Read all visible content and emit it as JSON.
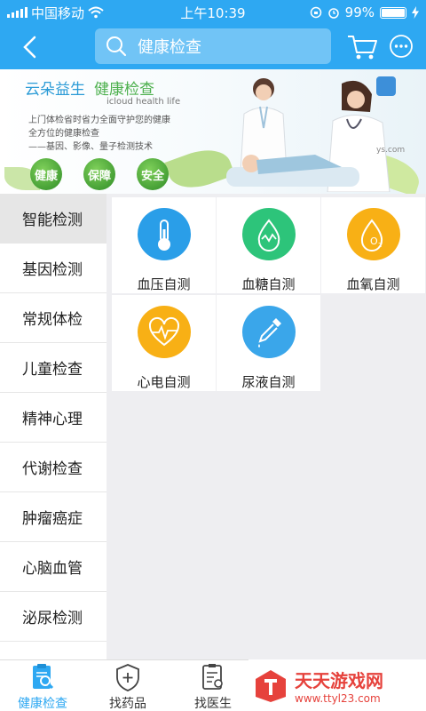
{
  "status_bar": {
    "carrier": "中国移动",
    "time": "上午10:39",
    "battery_percent": "99%",
    "battery_level": 0.99
  },
  "header": {
    "back_icon": "back-chevron-icon",
    "search_placeholder": "健康检查",
    "cart_icon": "cart-icon",
    "more_icon": "more-icon"
  },
  "banner": {
    "brand_left": "云朵益生",
    "brand_right": "健康检查",
    "subtitle": "icloud health life",
    "line1": "上门体检省时省力全面守护您的健康",
    "line2": "全方位的健康检查",
    "line3": "——基因、影像、量子检测技术",
    "badges": [
      "健康",
      "保障",
      "安全"
    ],
    "website_fragment": "ys.com"
  },
  "sidebar": {
    "items": [
      {
        "label": "智能检测",
        "active": true
      },
      {
        "label": "基因检测"
      },
      {
        "label": "常规体检"
      },
      {
        "label": "儿童检查"
      },
      {
        "label": "精神心理"
      },
      {
        "label": "代谢检查"
      },
      {
        "label": "肿瘤癌症"
      },
      {
        "label": "心脑血管"
      },
      {
        "label": "泌尿检测"
      }
    ]
  },
  "grid": {
    "items": [
      {
        "label": "血压自测",
        "icon": "thermometer-icon",
        "color": "#2a9ee8"
      },
      {
        "label": "血糖自测",
        "icon": "drop-wave-icon",
        "color": "#2dc47a"
      },
      {
        "label": "血氧自测",
        "icon": "o2-drop-icon",
        "color": "#f8b015"
      },
      {
        "label": "心电自测",
        "icon": "heart-pulse-icon",
        "color": "#f8b015"
      },
      {
        "label": "尿液自测",
        "icon": "dropper-icon",
        "color": "#3aa6ea"
      }
    ]
  },
  "bottom_nav": {
    "items": [
      {
        "label": "健康检查",
        "icon": "clipboard-search-icon",
        "active": true
      },
      {
        "label": "找药品",
        "icon": "shield-plus-icon"
      },
      {
        "label": "找医生",
        "icon": "doctor-list-icon"
      }
    ]
  },
  "watermark": {
    "title": "天天游戏网",
    "url": "www.ttyl23.com"
  },
  "colors": {
    "primary": "#2ea8f2",
    "search_bg": "#71c4f6",
    "active_sidebar": "#e6e6e6"
  }
}
